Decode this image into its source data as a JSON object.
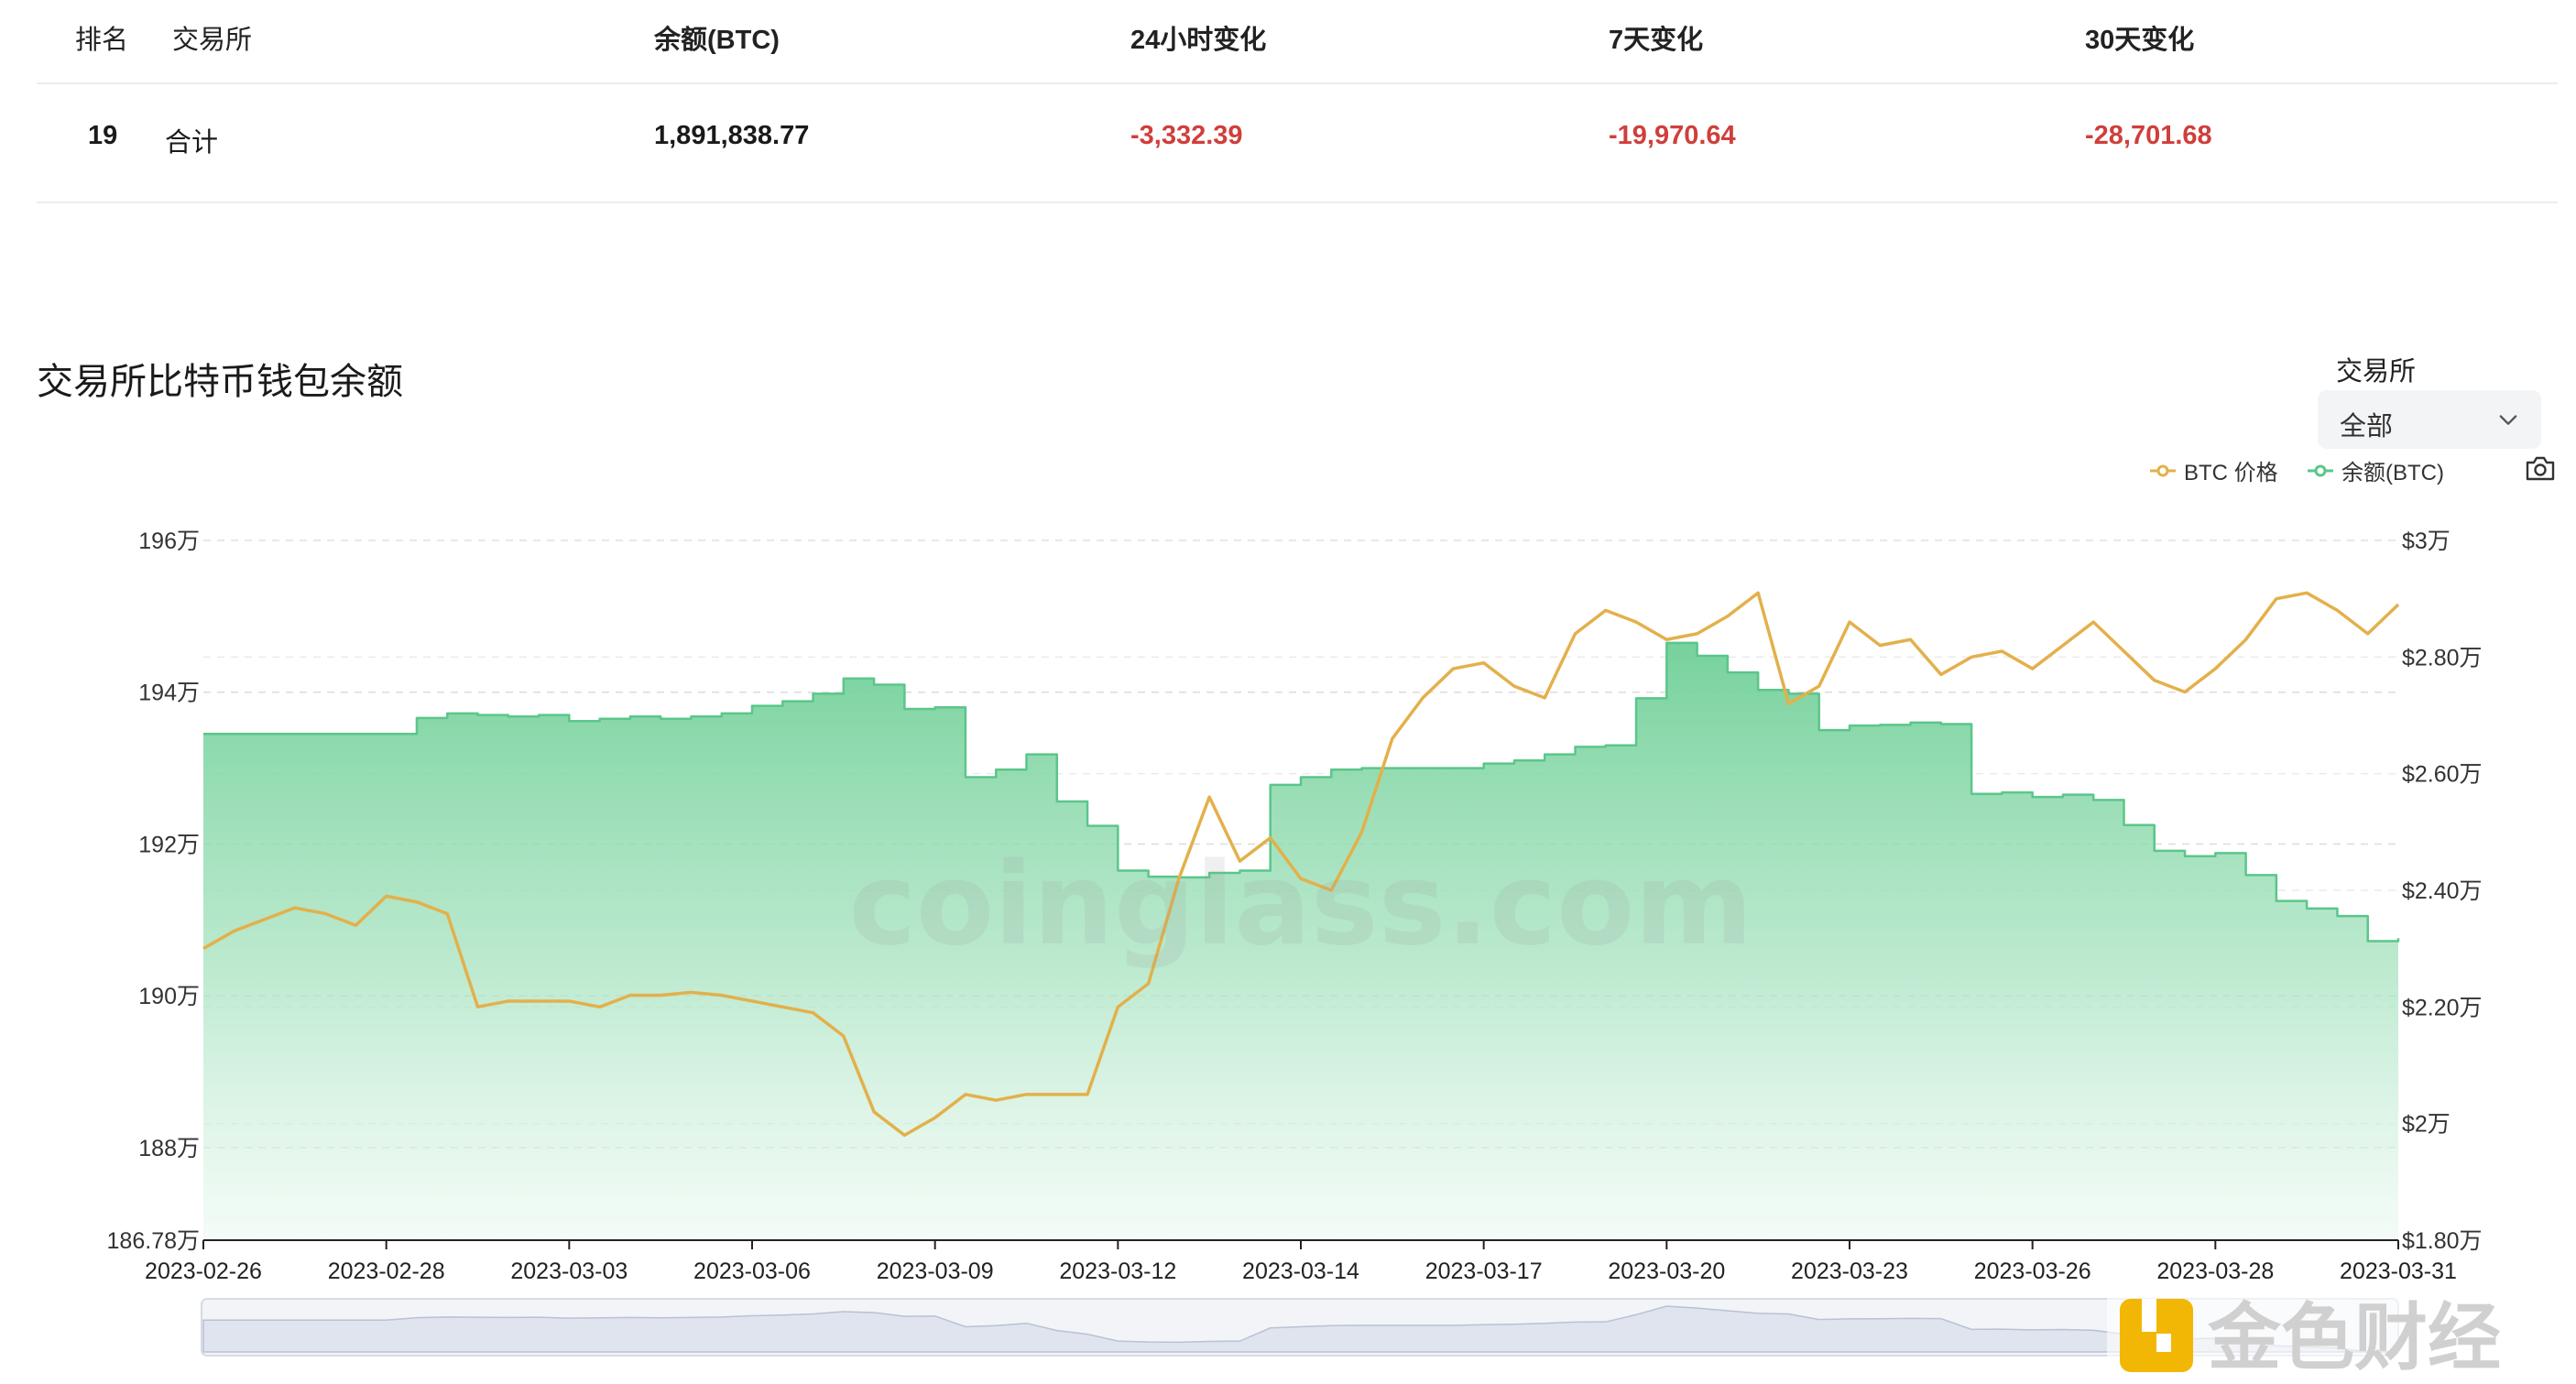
{
  "table": {
    "headers": {
      "rank": "排名",
      "exchange": "交易所",
      "balance": "余额(BTC)",
      "change_24h": "24小时变化",
      "change_7d": "7天变化",
      "change_30d": "30天变化"
    },
    "row": {
      "rank": "19",
      "exchange": "合计",
      "balance": "1,891,838.77",
      "change_24h": "-3,332.39",
      "change_7d": "-19,970.64",
      "change_30d": "-28,701.68"
    }
  },
  "section": {
    "title": "交易所比特币钱包余额"
  },
  "filter": {
    "label": "交易所",
    "selected": "全部"
  },
  "legend": {
    "price": "BTC 价格",
    "balance": "余额(BTC)"
  },
  "watermark": "coinglass.com",
  "logo_text": "金色财经",
  "colors": {
    "price_line": "#e3b04b",
    "balance_line": "#5bc68a",
    "negative": "#cf3f3b"
  },
  "chart_data": {
    "type": "area",
    "x_ticks": [
      "2023-02-26",
      "2023-02-28",
      "2023-03-03",
      "2023-03-06",
      "2023-03-09",
      "2023-03-12",
      "2023-03-14",
      "2023-03-17",
      "2023-03-20",
      "2023-03-23",
      "2023-03-26",
      "2023-03-28",
      "2023-03-31"
    ],
    "x_tick_index": [
      0,
      6,
      12,
      18,
      24,
      30,
      36,
      42,
      48,
      54,
      60,
      66,
      72
    ],
    "left_axis": {
      "ticks": [
        1867800,
        1880000,
        1900000,
        1920000,
        1940000,
        1960000
      ],
      "tick_labels": [
        "186.78万",
        "188万",
        "190万",
        "192万",
        "194万",
        "196万"
      ],
      "min": 1867800,
      "max": 1960000
    },
    "right_axis": {
      "ticks": [
        18000,
        20000,
        22000,
        24000,
        26000,
        28000,
        30000
      ],
      "tick_labels": [
        "$1.80万",
        "$2万",
        "$2.20万",
        "$2.40万",
        "$2.60万",
        "$2.80万",
        "$3万"
      ],
      "min": 18000,
      "max": 30000
    },
    "grid": true,
    "series": [
      {
        "name": "余额(BTC)",
        "axis": "left",
        "style": "area",
        "values": [
          1934500,
          1934500,
          1934500,
          1934500,
          1934500,
          1934500,
          1934500,
          1936600,
          1937200,
          1937000,
          1936800,
          1937000,
          1936200,
          1936500,
          1936800,
          1936500,
          1936800,
          1937200,
          1938200,
          1938800,
          1939800,
          1941800,
          1941000,
          1937800,
          1938000,
          1928800,
          1929800,
          1931800,
          1925600,
          1922400,
          1916500,
          1915700,
          1915600,
          1916200,
          1916500,
          1927800,
          1928800,
          1929800,
          1930000,
          1930000,
          1930000,
          1930000,
          1930600,
          1931000,
          1931800,
          1932800,
          1933000,
          1939200,
          1946500,
          1944800,
          1942600,
          1940300,
          1939800,
          1935000,
          1935600,
          1935700,
          1936000,
          1935800,
          1926600,
          1926800,
          1926200,
          1926500,
          1925800,
          1922500,
          1919100,
          1918400,
          1918800,
          1915900,
          1912500,
          1911500,
          1910500,
          1907200,
          1907600
        ]
      },
      {
        "name": "BTC 价格",
        "axis": "right",
        "style": "line",
        "values": [
          23000,
          23300,
          23500,
          23700,
          23600,
          23400,
          23900,
          23800,
          23600,
          22000,
          22100,
          22100,
          22100,
          22000,
          22200,
          22200,
          22250,
          22200,
          22100,
          22000,
          21900,
          21500,
          20200,
          19800,
          20100,
          20500,
          20400,
          20500,
          20500,
          20500,
          22000,
          22400,
          24200,
          25600,
          24500,
          24900,
          24200,
          24000,
          25000,
          26600,
          27300,
          27800,
          27900,
          27500,
          27300,
          28400,
          28800,
          28600,
          28300,
          28400,
          28700,
          29100,
          27200,
          27500,
          28600,
          28200,
          28300,
          27700,
          28000,
          28100,
          27800,
          28200,
          28600,
          28100,
          27600,
          27400,
          27800,
          28300,
          29000,
          29100,
          28800,
          28400,
          28900
        ]
      }
    ]
  }
}
